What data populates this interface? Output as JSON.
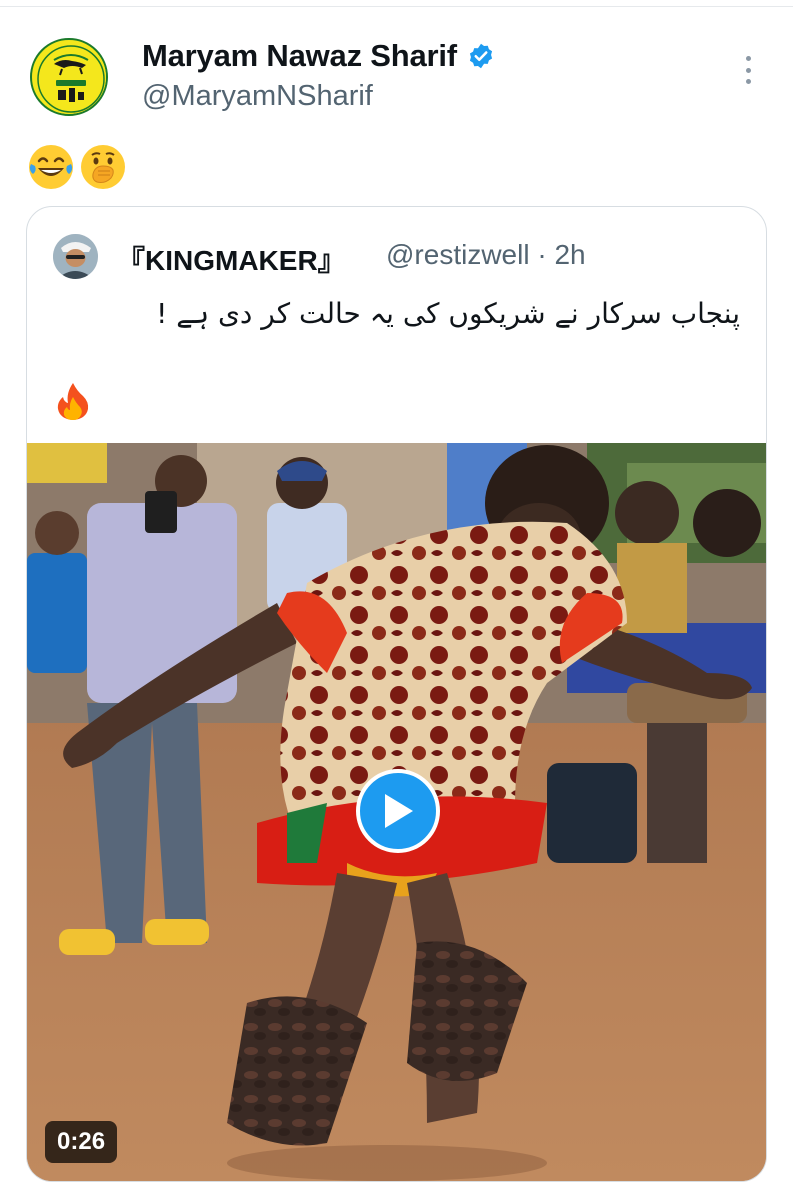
{
  "tweet": {
    "author_name": "Maryam Nawaz Sharif",
    "author_handle": "@MaryamNSharif",
    "text_emojis": [
      "😂",
      "🤭"
    ],
    "icons": {
      "avatar": "party-logo-avatar",
      "verified": "verified-badge-icon",
      "more": "more-options-icon"
    },
    "colors": {
      "verified_badge": "#1d9bf0",
      "handle_text": "#536471",
      "avatar_bg": "#f4e71c"
    }
  },
  "quote": {
    "author_name": "『KINGMAKER』",
    "author_handle": "@restizwell",
    "separator": " · ",
    "time": "2h",
    "text": "پنجاب سرکار نے شریکوں کی یہ حالت کر دی ہے !",
    "emoji": "🔥",
    "media": {
      "type": "video",
      "duration": "0:26",
      "play_icon": "play-icon",
      "description_icon": "video-thumbnail"
    }
  }
}
